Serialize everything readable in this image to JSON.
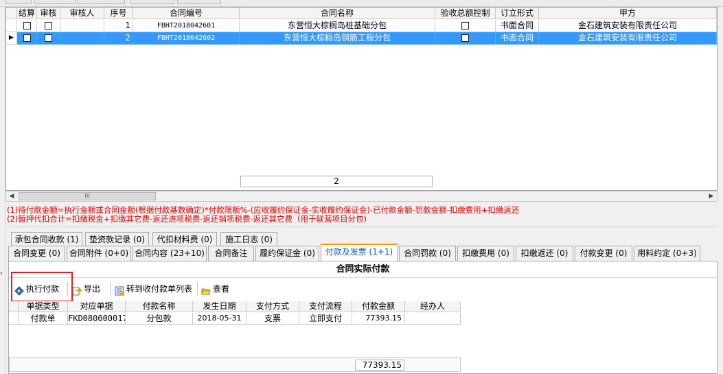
{
  "grid1": {
    "columns": [
      "结算",
      "审核",
      "审核人",
      "序号",
      "合同编号",
      "合同名称",
      "验收总额控制",
      "订立形式",
      "甲方"
    ],
    "rows": [
      {
        "seq": "1",
        "code": "FBHT2018042601",
        "name": "东营恒大棕榈岛桩基础分包",
        "form": "书面合同",
        "party_a": "金石建筑安装有限责任公司",
        "selected": false
      },
      {
        "seq": "2",
        "code": "FBHT2018042602",
        "name": "东营恒大棕榈岛钢筋工程分包",
        "form": "书面合同",
        "party_a": "金石建筑安装有限责任公司",
        "selected": true
      }
    ],
    "footer_count": "2"
  },
  "scrollbar": {
    "thumb_label": "III"
  },
  "notes": [
    "(1)待付款金额=执行金额或合同金额(根据付款基数确定)*付款限额%-(应收履约保证金-实收履约保证金)-已付款金额-罚款金额-扣缴费用+扣缴返还",
    "(2)暂押代扣合计=扣缴税金+扣缴其它费-返还进项税费-返还销项税费-返还其它费（用于联营项目分包)"
  ],
  "tabs_row1": [
    {
      "label": "承包合同收款 (1)"
    },
    {
      "label": "垫资款记录 (0)"
    },
    {
      "label": "代扣材料费 (0)"
    },
    {
      "label": "施工日志 (0)"
    }
  ],
  "tabs_row2": [
    {
      "label": "合同变更 (0)"
    },
    {
      "label": "合同附件 (0+0)"
    },
    {
      "label": "合同内容 (23+10)"
    },
    {
      "label": "合同备注"
    },
    {
      "label": "履约保证金 (0)"
    },
    {
      "label": "付款及发票 (1+1)",
      "active": true
    },
    {
      "label": "合同罚款 (0)"
    },
    {
      "label": "扣缴费用 (0)"
    },
    {
      "label": "扣缴返还 (0)"
    },
    {
      "label": "付款变更 (0)"
    },
    {
      "label": "用料约定 (0+3)"
    }
  ],
  "panel": {
    "title": "合同实际付款",
    "toolbar": {
      "execute_payment": "执行付款",
      "export": "导出",
      "to_list": "转到收付款单列表",
      "view": "查看"
    }
  },
  "grid2": {
    "columns": [
      "单据类型",
      "对应单据",
      "付款名称",
      "发生日期",
      "支付方式",
      "支付流程",
      "付款金额",
      "经办人"
    ],
    "rows": [
      {
        "type": "付款单",
        "doc": "FKD080000017",
        "pay_name": "分包款",
        "date": "2018-05-31",
        "method": "支票",
        "flow": "立即支付",
        "amount": "77393.15",
        "handler": ""
      }
    ],
    "total": "77393.15"
  },
  "colors": {
    "selection": "#3399ff",
    "note_red": "#e00000",
    "highlight_box": "#e02020",
    "active_tab_text": "#1a5fb4"
  }
}
